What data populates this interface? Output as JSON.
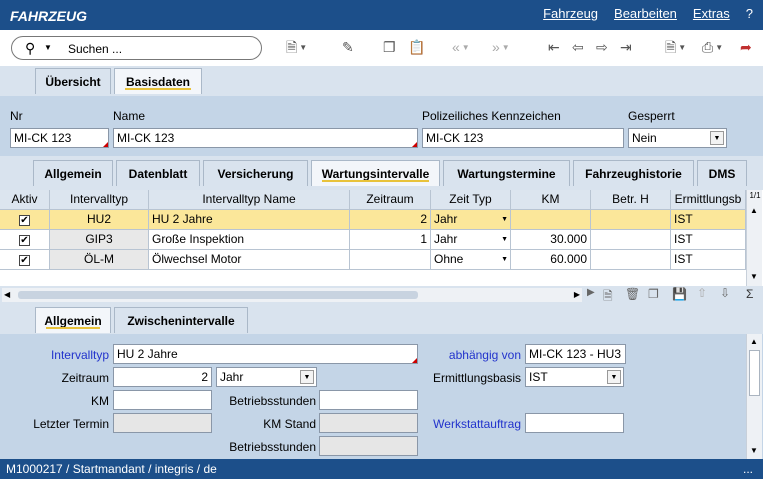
{
  "app": {
    "title": "FAHRZEUG"
  },
  "menu": {
    "items": [
      "Fahrzeug",
      "Bearbeiten",
      "Extras",
      "?"
    ]
  },
  "toolbar": {
    "search_placeholder": "Suchen ..."
  },
  "top_tabs": [
    "Übersicht",
    "Basisdaten"
  ],
  "header": {
    "nr_label": "Nr",
    "nr_value": "MI-CK 123",
    "name_label": "Name",
    "name_value": "MI-CK 123",
    "kennz_label": "Polizeiliches Kennzeichen",
    "kennz_value": "MI-CK 123",
    "gesperrt_label": "Gesperrt",
    "gesperrt_value": "Nein"
  },
  "sub_tabs": [
    "Allgemein",
    "Datenblatt",
    "Versicherung",
    "Wartungsintervalle",
    "Wartungstermine",
    "Fahrzeughistorie",
    "DMS"
  ],
  "grid": {
    "columns": [
      "Aktiv",
      "Intervalltyp",
      "Intervalltyp Name",
      "Zeitraum",
      "Zeit Typ",
      "KM",
      "Betr. H",
      "Ermittlungsb"
    ],
    "page_indicator": "1/1",
    "rows": [
      {
        "aktiv": "✔",
        "typ": "HU2",
        "name": "HU 2 Jahre",
        "zeitraum": "2",
        "zeittyp": "Jahr",
        "km": "",
        "betr": "",
        "ermittlung": "IST"
      },
      {
        "aktiv": "✔",
        "typ": "GIP3",
        "name": "Große Inspektion",
        "zeitraum": "1",
        "zeittyp": "Jahr",
        "km": "30.000",
        "betr": "",
        "ermittlung": "IST"
      },
      {
        "aktiv": "✔",
        "typ": "ÖL-M",
        "name": "Ölwechsel Motor",
        "zeitraum": "",
        "zeittyp": "Ohne",
        "km": "60.000",
        "betr": "",
        "ermittlung": "IST"
      }
    ],
    "sigma": "Σ"
  },
  "detail_tabs": [
    "Allgemein",
    "Zwischenintervalle"
  ],
  "detail": {
    "intervalltyp_label": "Intervalltyp",
    "intervalltyp_value": "HU 2 Jahre",
    "abhaengig_label": "abhängig von",
    "abhaengig_value": "MI-CK 123 - HU3",
    "zeitraum_label": "Zeitraum",
    "zeitraum_value": "2",
    "zeitraum_typ": "Jahr",
    "ermittlung_label": "Ermittlungsbasis",
    "ermittlung_value": "IST",
    "km_label": "KM",
    "km_value": "",
    "betriebsstunden_label": "Betriebsstunden",
    "betriebsstunden_value": "",
    "letzter_termin_label": "Letzter Termin",
    "letzter_termin_value": "",
    "km_stand_label": "KM Stand",
    "km_stand_value": "",
    "werkstatt_label": "Werkstattauftrag",
    "werkstatt_value": "",
    "betriebsstunden2_label": "Betriebsstunden",
    "betriebsstunden2_value": ""
  },
  "status": {
    "text": "M1000217 / Startmandant / integris / de",
    "dots": "..."
  },
  "colors": {
    "titlebar": "#1c4f8a",
    "selected_row": "#fbe79a",
    "tab_underline": "#e8c23a",
    "link_blue": "#2233cc"
  }
}
